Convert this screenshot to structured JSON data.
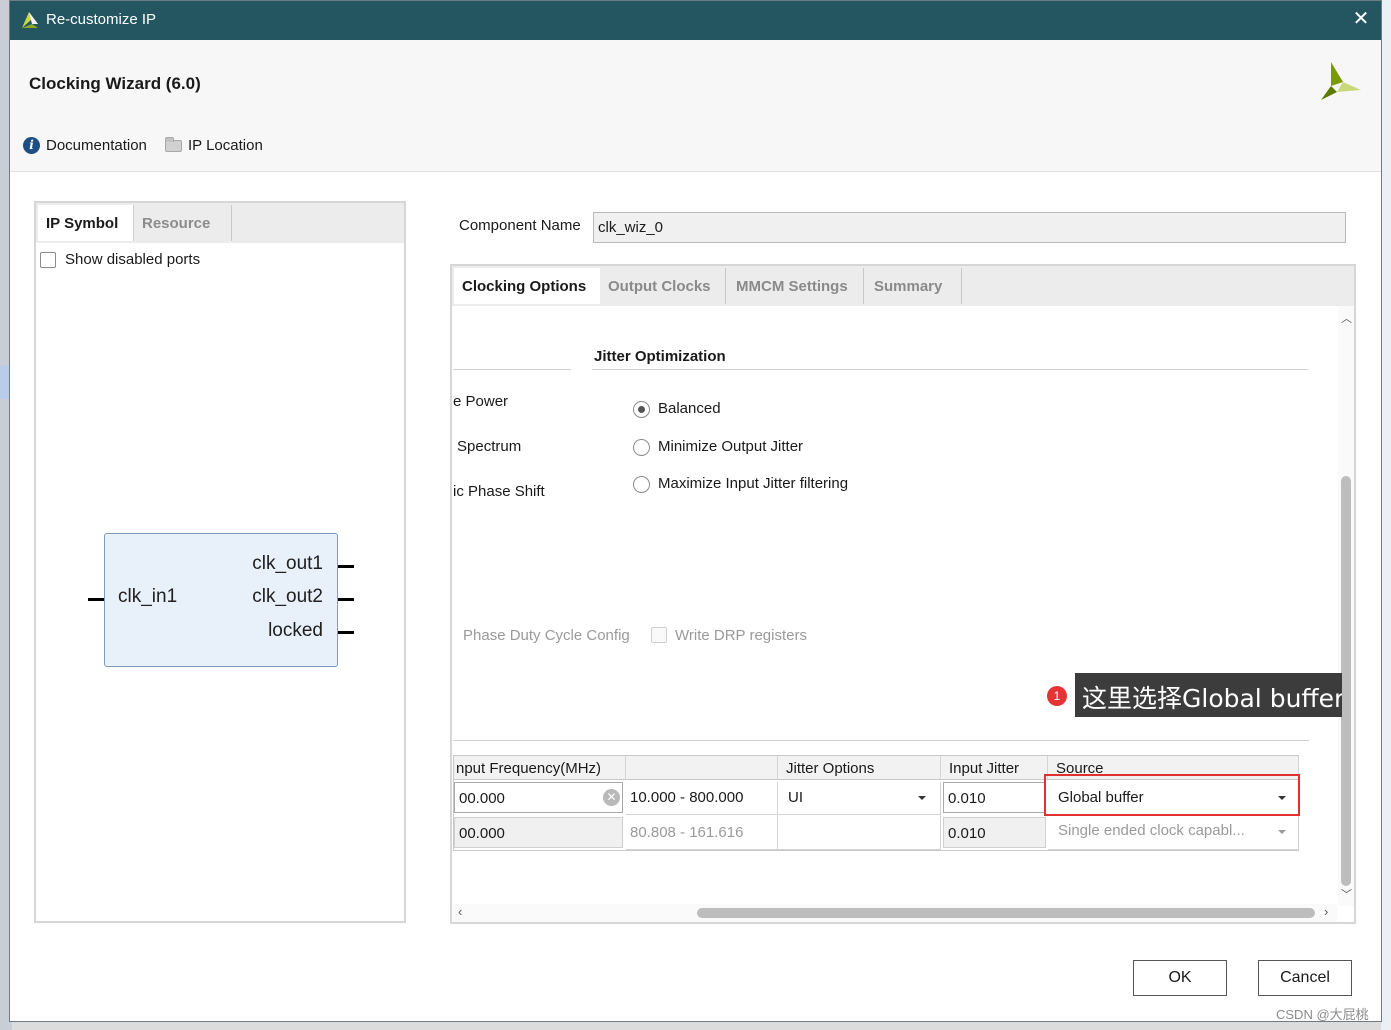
{
  "window": {
    "title": "Re-customize IP"
  },
  "header": {
    "heading": "Clocking Wizard (6.0)",
    "links": {
      "documentation": "Documentation",
      "ip_location": "IP Location"
    }
  },
  "left_panel": {
    "tabs": [
      "IP Symbol",
      "Resource"
    ],
    "show_disabled_ports": "Show disabled ports",
    "ports": {
      "input": "clk_in1",
      "outputs": [
        "clk_out1",
        "clk_out2",
        "locked"
      ]
    }
  },
  "component": {
    "label": "Component Name",
    "value": "clk_wiz_0"
  },
  "right_panel": {
    "tabs": [
      "Clocking Options",
      "Output Clocks",
      "MMCM Settings",
      "Summary"
    ],
    "jitter_optimization": {
      "title": "Jitter Optimization",
      "options": [
        "Balanced",
        "Minimize Output Jitter",
        "Maximize Input Jitter filtering"
      ],
      "selected": "Balanced"
    },
    "clipped_labels": [
      "e Power",
      "Spectrum",
      "ic Phase Shift"
    ],
    "disabled_options": [
      "Phase Duty Cycle Config",
      "Write DRP registers"
    ],
    "input_table": {
      "headers": [
        "nput Frequency(MHz)",
        "",
        "Jitter Options",
        "Input Jitter",
        "Source"
      ],
      "rows": [
        {
          "freq": "00.000",
          "range": "10.000 - 800.000",
          "jitter_option": "UI",
          "input_jitter": "0.010",
          "source": "Global buffer"
        },
        {
          "freq": "00.000",
          "range": "80.808 - 161.616",
          "jitter_option": "",
          "input_jitter": "0.010",
          "source": "Single ended clock capabl..."
        }
      ]
    }
  },
  "annotation": {
    "number": "1",
    "text": "这里选择Global buffer"
  },
  "footer": {
    "ok": "OK",
    "cancel": "Cancel"
  },
  "watermark": "CSDN @大屁桃",
  "colors": {
    "titlebar": "#235660",
    "annotation_red": "#e03030",
    "logo_green": "#7a9a01"
  }
}
